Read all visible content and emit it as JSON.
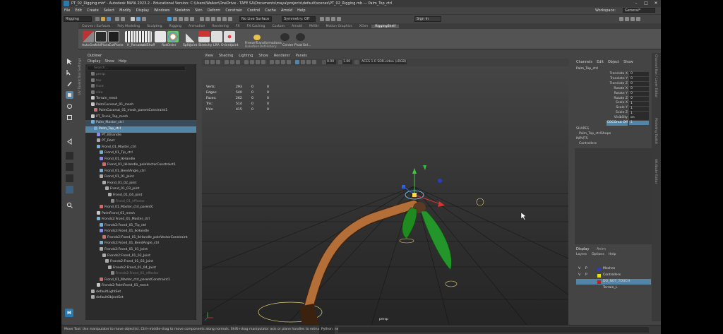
{
  "window": {
    "title": "PT_02_Rigging.mb* - Autodesk MAYA 2023.2 - Educational Version: C:\\Users\\Walker\\OneDrive - TAFE SA\\Documents\\maya\\projects\\default\\scenes\\PT_02_Rigging.mb  ---  Palm_Top_ctrl"
  },
  "menubar": {
    "items": [
      "File",
      "Edit",
      "Create",
      "Select",
      "Modify",
      "Display",
      "Windows",
      "Skeleton",
      "Skin",
      "Deform",
      "Constrain",
      "Control",
      "Cache",
      "Arnold",
      "Help"
    ],
    "workspace_label": "Workspace:",
    "workspace_value": "General*"
  },
  "statusline": {
    "mode": "Rigging",
    "no_live_surface": "No Live Surface",
    "symmetry": "Symmetry: Off",
    "sign_in": "Sign In"
  },
  "shelf": {
    "tabs": [
      "Curves / Surfaces",
      "Poly Modeling",
      "Sculpting",
      "Rigging",
      "Animation",
      "Rendering",
      "FX",
      "FX Caching",
      "Custom",
      "Arnold",
      "MASH",
      "Motion Graphics",
      "XGen",
      "RiggingShelf"
    ],
    "active_tab": "RiggingShelf",
    "labels": [
      "AutoGeo",
      "AddPlane",
      "CutPlane",
      "H_Rename",
      "addShuff",
      "RotOrder",
      "SplitJoint",
      "Stretchy",
      "LRA",
      "OrientJoint",
      "FreezeTransformations",
      "Center Pivot",
      "Sel..."
    ],
    "freeze_sub": "BakeNonDefHistory"
  },
  "outliner": {
    "title": "Outliner",
    "menu": [
      "Display",
      "Show",
      "Help"
    ],
    "search_placeholder": "Search...",
    "rows": [
      {
        "label": "persp",
        "dim": true
      },
      {
        "label": "top",
        "dim": true
      },
      {
        "label": "front",
        "dim": true
      },
      {
        "label": "side",
        "dim": true
      },
      {
        "label": "Terrain_mesh"
      },
      {
        "label": "PalmCoconut_01_mesh"
      },
      {
        "label": "PalmCoconut_01_mesh_parentConstraint1"
      },
      {
        "label": "PT_Trunk_Top_mesh"
      },
      {
        "label": "Palm_Master_ctrl"
      },
      {
        "label": "Palm_Top_ctrl",
        "selected": true
      },
      {
        "label": "PT_IKhandle"
      },
      {
        "label": "PT_Root"
      },
      {
        "label": "Frond_01_Master_ctrl"
      },
      {
        "label": "Frond_01_Tip_ctrl"
      },
      {
        "label": "Frond_01_IkHandle"
      },
      {
        "label": "Frond_01_IkHandle_poleVectorConstraint1"
      },
      {
        "label": "Frond_01_BendAngle_ctrl"
      },
      {
        "label": "Frond_01_01_Joint"
      },
      {
        "label": "Frond_01_02_joint"
      },
      {
        "label": "Frond_01_03_joint"
      },
      {
        "label": "Frond_01_04_joint"
      },
      {
        "label": "Frond_01_effector",
        "dim": true
      },
      {
        "label": "Frond_01_Master_ctrl_parentC"
      },
      {
        "label": "PalmFrond_01_mesh"
      },
      {
        "label": "Fronds2:Frond_01_Master_ctrl"
      },
      {
        "label": "Fronds2:Frond_01_Tip_ctrl"
      },
      {
        "label": "Fronds2:Frond_01_IkHandle"
      },
      {
        "label": "Fronds2:Frond_01_IkHandle_poleVectorConstraint"
      },
      {
        "label": "Fronds2:Frond_01_BendAngle_ctrl"
      },
      {
        "label": "Fronds2:Frond_01_01_Joint"
      },
      {
        "label": "Fronds2:Frond_01_02_Joint"
      },
      {
        "label": "Fronds2:Frond_01_03_joint"
      },
      {
        "label": "Fronds2:Frond_01_04_Joint"
      },
      {
        "label": "Fronds2:Frond_01_effector",
        "dim": true
      },
      {
        "label": "Frond_01_Master_ctrl_parentConstraint1"
      },
      {
        "label": "Fronds2:PalmFrond_01_mesh"
      },
      {
        "label": "defaultLightSet"
      },
      {
        "label": "defaultObjectSet"
      }
    ]
  },
  "viewport": {
    "menu": [
      "View",
      "Shading",
      "Lighting",
      "Show",
      "Renderer",
      "Panels"
    ],
    "exposure": "0.00",
    "gamma": "1.00",
    "colorspace": "ACES 1.0 SDR-video (sRGB)",
    "camera_label": "persp",
    "hud": [
      {
        "label": "Verts:",
        "values": [
          "293",
          "0",
          "0"
        ]
      },
      {
        "label": "Edges:",
        "values": [
          "540",
          "0",
          "0"
        ]
      },
      {
        "label": "Faces:",
        "values": [
          "262",
          "0",
          "0"
        ]
      },
      {
        "label": "Tris:",
        "values": [
          "514",
          "0",
          "0"
        ]
      },
      {
        "label": "UVs:",
        "values": [
          "415",
          "0",
          "0"
        ]
      }
    ]
  },
  "channelbox": {
    "tabs": [
      "Channels",
      "Edit",
      "Object",
      "Show"
    ],
    "object": "Palm_Top_ctrl",
    "attributes": [
      {
        "name": "Translate X",
        "value": "0"
      },
      {
        "name": "Translate Y",
        "value": "0"
      },
      {
        "name": "Translate Z",
        "value": "0"
      },
      {
        "name": "Rotate X",
        "value": "0"
      },
      {
        "name": "Rotate Y",
        "value": "0"
      },
      {
        "name": "Rotate Z",
        "value": "0"
      },
      {
        "name": "Scale X",
        "value": "1"
      },
      {
        "name": "Scale Y",
        "value": "1"
      },
      {
        "name": "Scale Z",
        "value": "1"
      },
      {
        "name": "Visibility",
        "value": "on"
      },
      {
        "name": "COCOnut Off",
        "value": "1",
        "selected": true
      }
    ],
    "shapes_header": "SHAPES",
    "shape": "Palm_Top_ctrlShape",
    "inputs_header": "INPUTS",
    "input": "Controllers"
  },
  "layers": {
    "tabs": [
      "Display",
      "Anim"
    ],
    "menu": [
      "Layers",
      "Options",
      "Help"
    ],
    "rows": [
      {
        "v": "V",
        "p": "P",
        "name": "Meshes",
        "color": "#2a3cc8"
      },
      {
        "v": "V",
        "p": "P",
        "name": "Controllers",
        "color": "#e6e21a"
      },
      {
        "v": "",
        "p": "",
        "name": "DO_NOT_TOUCH",
        "color": "#c81a1a",
        "selected": true
      },
      {
        "v": "",
        "p": "",
        "name": "Terrain_L",
        "color": "#444444"
      }
    ]
  },
  "right_tabs": [
    "Channel Box / Layer Editor",
    "Modeling Toolkit",
    "Attribute Editor"
  ],
  "left_tabs": [
    "Tool Settings",
    "UV Toolkit"
  ],
  "helpline": {
    "text": "Move Tool: Use manipulator to move object(s). Ctrl+middle-drag to move components along normals. Shift+drag manipulator axis or plane handles to extrude components or c",
    "python": "Python"
  },
  "colors": {
    "selection": "#5285a6",
    "panel": "#444444",
    "viewport_bg_top": "#3f3f3f",
    "viewport_bg_bottom": "#262626"
  }
}
